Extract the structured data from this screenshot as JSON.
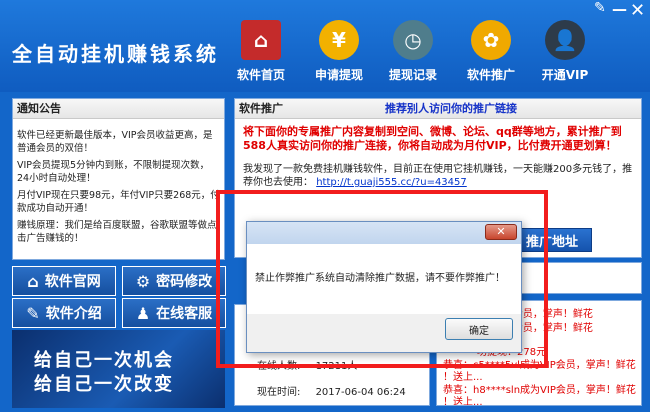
{
  "window": {
    "title": "全自动挂机赚钱系统",
    "skin_icon": "pen-icon",
    "close_glyph": "✕"
  },
  "nav": [
    {
      "label": "软件首页",
      "icon": "home-icon"
    },
    {
      "label": "申请提现",
      "icon": "yen-icon"
    },
    {
      "label": "提现记录",
      "icon": "clock-icon"
    },
    {
      "label": "软件推广",
      "icon": "flower-icon"
    },
    {
      "label": "开通VIP",
      "icon": "user-icon"
    }
  ],
  "notice": {
    "title": "通知公告",
    "paragraphs": [
      "软件已经更新最佳版本，VIP会员收益更高，是普通会员的双倍！",
      "VIP会员提现5分钟内到账，不限制提现次数，24小时自动处理！",
      "月付VIP现在只要98元，年付VIP只要268元，付款成功自动开通！",
      "赚钱原理：我们是给百度联盟，谷歌联盟等做点击广告赚钱的！"
    ]
  },
  "buttons": {
    "official_site": "软件官网",
    "change_password": "密码修改",
    "introduction": "软件介绍",
    "online_service": "在线客服"
  },
  "banner": {
    "line1": "给自己一次机会",
    "line2": "给自己一次改变"
  },
  "promo": {
    "tab": "软件推广",
    "heading": "推荐别人访问你的推广链接",
    "red_text": "将下面你的专属推广内容复制到空间、微博、论坛、qq群等地方，累计推广到588人真实访问你的推广连接，你将自动成为月付VIP，比付费开通更划算！",
    "share_text": "我发现了一款免费挂机赚钱软件，目前正在使用它挂机赚钱，一天能赚200多元钱了，推荐你也去使用：",
    "link": "http://t.guaji555.cc/?u=43457",
    "address_button": "推广地址"
  },
  "stats": {
    "online_label": "在线人数:",
    "online_value": "17211人",
    "time_label": "现在时间:",
    "time_value": "2017-06-04 06:24"
  },
  "ticker": [
    "成为VIP会员，掌声！鲜花",
    "成为VIP会员，掌声！鲜花",
    "功提现：278元",
    "恭喜：c5****5vl成为VIP会员，掌声！鲜花",
    "！送上...",
    "恭喜：h8****sln成为VIP会员，掌声！鲜花",
    "！送上..."
  ],
  "dialog": {
    "message": "禁止作弊推广系统自动清除推广数据，请不要作弊推广！",
    "ok": "确定"
  }
}
